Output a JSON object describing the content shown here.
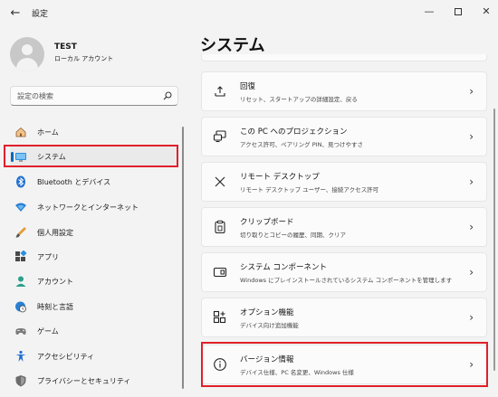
{
  "window": {
    "title": "設定",
    "back_glyph": "←",
    "min_glyph": "—",
    "close_glyph": "✕"
  },
  "profile": {
    "name": "TEST",
    "account_type": "ローカル アカウント"
  },
  "search": {
    "placeholder": "設定の検索"
  },
  "nav": {
    "items": [
      {
        "label": "ホーム",
        "icon": "home-icon"
      },
      {
        "label": "システム",
        "icon": "system-icon",
        "active": true
      },
      {
        "label": "Bluetooth とデバイス",
        "icon": "bluetooth-icon"
      },
      {
        "label": "ネットワークとインターネット",
        "icon": "network-icon"
      },
      {
        "label": "個人用設定",
        "icon": "brush-icon"
      },
      {
        "label": "アプリ",
        "icon": "apps-icon"
      },
      {
        "label": "アカウント",
        "icon": "account-icon"
      },
      {
        "label": "時刻と言語",
        "icon": "clock-globe-icon"
      },
      {
        "label": "ゲーム",
        "icon": "gamepad-icon"
      },
      {
        "label": "アクセシビリティ",
        "icon": "accessibility-icon"
      },
      {
        "label": "プライバシーとセキュリティ",
        "icon": "shield-icon"
      }
    ]
  },
  "main": {
    "title": "システム",
    "cards": [
      {
        "title": "回復",
        "subtitle": "リセット、スタートアップの詳細設定、戻る",
        "icon": "recovery-icon"
      },
      {
        "title": "この PC へのプロジェクション",
        "subtitle": "アクセス許可、ペアリング PIN、見つけやすさ",
        "icon": "projection-icon"
      },
      {
        "title": "リモート デスクトップ",
        "subtitle": "リモート デスクトップ ユーザー、接続アクセス許可",
        "icon": "remote-desktop-icon"
      },
      {
        "title": "クリップボード",
        "subtitle": "切り取りとコピーの履歴、同期、クリア",
        "icon": "clipboard-icon"
      },
      {
        "title": "システム コンポーネント",
        "subtitle": "Windows にプレインストールされているシステム コンポーネントを管理します",
        "icon": "system-components-icon"
      },
      {
        "title": "オプション機能",
        "subtitle": "デバイス向け追加機能",
        "icon": "optional-features-icon"
      },
      {
        "title": "バージョン情報",
        "subtitle": "デバイス仕様、PC 名変更、Windows 仕様",
        "icon": "info-icon"
      }
    ],
    "chevron": "›"
  },
  "colors": {
    "accent": "#0067c0",
    "highlight": "#e0202a"
  }
}
